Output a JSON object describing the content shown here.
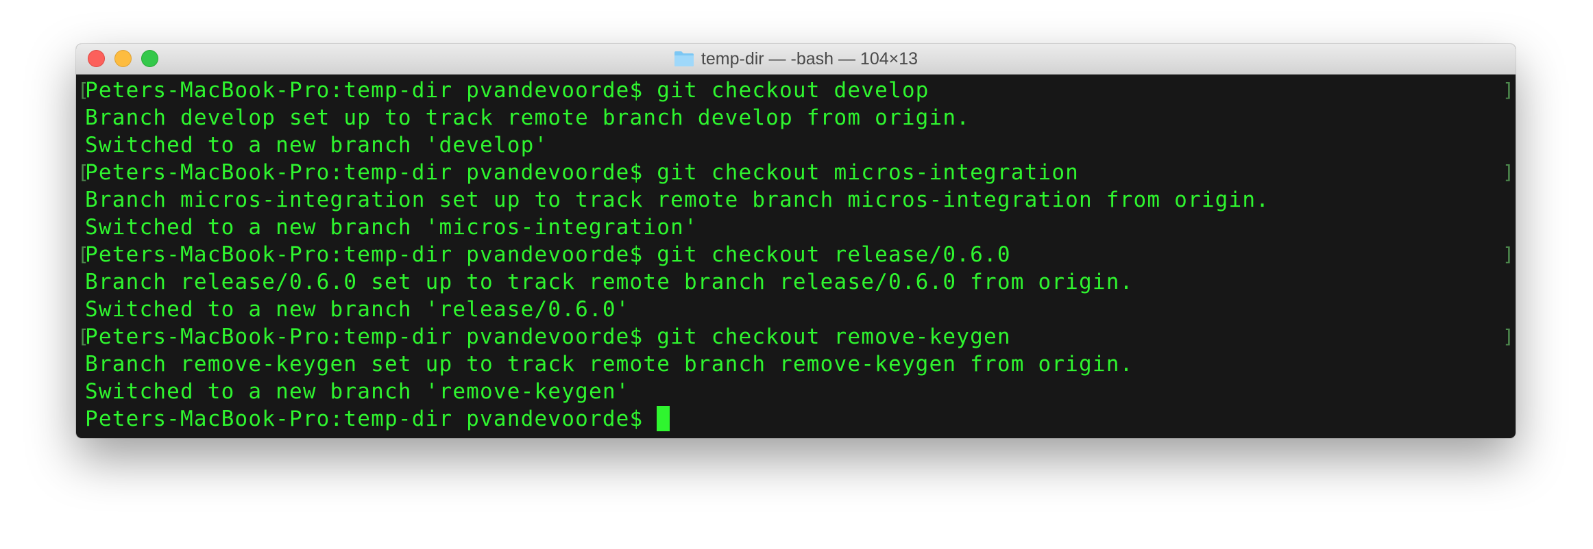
{
  "window": {
    "title": "temp-dir — -bash — 104×13",
    "title_icon": "folder-icon",
    "colors": {
      "text": "#2ff52f",
      "background": "#171717",
      "mark": "#4d8a4d"
    }
  },
  "terminal": {
    "lines": [
      {
        "text": "Peters-MacBook-Pro:temp-dir pvandevoorde$ git checkout develop",
        "marked": true
      },
      {
        "text": "Branch develop set up to track remote branch develop from origin.",
        "marked": false
      },
      {
        "text": "Switched to a new branch 'develop'",
        "marked": false
      },
      {
        "text": "Peters-MacBook-Pro:temp-dir pvandevoorde$ git checkout micros-integration",
        "marked": true
      },
      {
        "text": "Branch micros-integration set up to track remote branch micros-integration from origin.",
        "marked": false
      },
      {
        "text": "Switched to a new branch 'micros-integration'",
        "marked": false
      },
      {
        "text": "Peters-MacBook-Pro:temp-dir pvandevoorde$ git checkout release/0.6.0",
        "marked": true
      },
      {
        "text": "Branch release/0.6.0 set up to track remote branch release/0.6.0 from origin.",
        "marked": false
      },
      {
        "text": "Switched to a new branch 'release/0.6.0'",
        "marked": false
      },
      {
        "text": "Peters-MacBook-Pro:temp-dir pvandevoorde$ git checkout remove-keygen",
        "marked": true
      },
      {
        "text": "Branch remove-keygen set up to track remote branch remove-keygen from origin.",
        "marked": false
      },
      {
        "text": "Switched to a new branch 'remove-keygen'",
        "marked": false
      }
    ],
    "prompt": "Peters-MacBook-Pro:temp-dir pvandevoorde$ "
  }
}
